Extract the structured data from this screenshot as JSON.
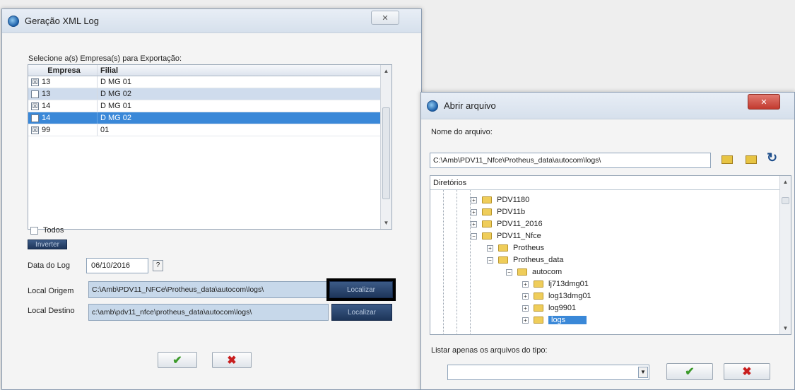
{
  "window1": {
    "title": "Geração XML Log",
    "close_label": "✕",
    "select_label": "Selecione a(s) Empresa(s) para Exportação:",
    "columns": [
      "Empresa",
      "Filial"
    ],
    "rows": [
      {
        "checked": true,
        "empresa": "13",
        "filial": "D MG 01"
      },
      {
        "checked": false,
        "empresa": "13",
        "filial": "D MG 02"
      },
      {
        "checked": true,
        "empresa": "14",
        "filial": "D MG 01"
      },
      {
        "checked": false,
        "empresa": "14",
        "filial": "D MG 02"
      },
      {
        "checked": true,
        "empresa": "99",
        "filial": "01"
      }
    ],
    "todos_label": "Todos",
    "inverter_label": "Inverter",
    "data_label": "Data do Log",
    "data_value": "06/10/2016",
    "help_label": "?",
    "origem_label": "Local Origem",
    "origem_value": "C:\\Amb\\PDV11_NFCe\\Protheus_data\\autocom\\logs\\",
    "destino_label": "Local Destino",
    "destino_value": "c:\\amb\\pdv11_nfce\\protheus_data\\autocom\\logs\\",
    "localizar_label": "Localizar",
    "ok_symbol": "✔",
    "cancel_symbol": "✖"
  },
  "window2": {
    "title": "Abrir arquivo",
    "close_label": "✕",
    "filename_label": "Nome do arquivo:",
    "filename_value": "C:\\Amb\\PDV11_Nfce\\Protheus_data\\autocom\\logs\\",
    "refresh_symbol": "↻",
    "dirs_label": "Diretórios",
    "tree": [
      {
        "label": "PDV1180",
        "sign": "+"
      },
      {
        "label": "PDV11b",
        "sign": "+"
      },
      {
        "label": "PDV11_2016",
        "sign": "+"
      },
      {
        "label": "PDV11_Nfce",
        "sign": "−"
      },
      {
        "label": "Protheus",
        "sign": "+"
      },
      {
        "label": "Protheus_data",
        "sign": "−"
      },
      {
        "label": "autocom",
        "sign": "−"
      },
      {
        "label": "lj713dmg01",
        "sign": "+"
      },
      {
        "label": "log13dmg01",
        "sign": "+"
      },
      {
        "label": "log9901",
        "sign": "+"
      },
      {
        "label": "logs",
        "sign": "+"
      }
    ],
    "filter_label": "Listar apenas os arquivos do tipo:",
    "filter_value": "",
    "ok_symbol": "✔",
    "cancel_symbol": "✖"
  },
  "colors": {
    "selection": "#3a88d8",
    "close_red": "#c9463d",
    "ok_green": "#3c9a2a",
    "cancel_red": "#c81e1e"
  }
}
